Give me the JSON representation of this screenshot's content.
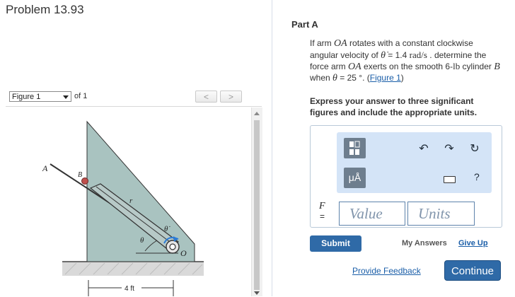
{
  "problem": {
    "title": "Problem 13.93"
  },
  "figure_nav": {
    "selected": "Figure 1",
    "of_text": "of 1",
    "prev_glyph": "<",
    "next_glyph": ">"
  },
  "figure": {
    "label_A": "A",
    "label_B": "B",
    "label_r": "r",
    "label_theta": "θ",
    "label_theta_dot": "θ̇",
    "label_O": "O",
    "dimension": "4 ft"
  },
  "part": {
    "title": "Part A",
    "text_1": "If arm ",
    "arm1": "OA",
    "text_2": " rotates with a constant clockwise angular velocity of ",
    "theta_dot": "θ̇",
    "text_3": " = 1.4 ",
    "unit_rad": "rad/s",
    "text_4": " . determine the force arm ",
    "arm2": "OA",
    "text_5": " exerts on the smooth 6-",
    "unit_lb": "lb",
    "text_6": " cylinder ",
    "cyl": "B",
    "text_7": " when ",
    "theta": "θ",
    "text_8": " = 25 °. (",
    "fig_link": "Figure 1",
    "text_9": ")",
    "express": "Express your answer to three significant figures and include the appropriate units."
  },
  "answer": {
    "var_label": "F",
    "eq": "=",
    "value_placeholder": "Value",
    "units_placeholder": "Units",
    "mu_label": "μÅ",
    "help": "?",
    "icons": [
      "templates-icon",
      "units-icon",
      "undo-icon",
      "redo-icon",
      "reset-icon",
      "keyboard-icon",
      "help-icon"
    ]
  },
  "actions": {
    "submit": "Submit",
    "my_answers": "My Answers",
    "give_up": "Give Up",
    "feedback": "Provide Feedback",
    "continue": "Continue"
  },
  "colors": {
    "accent": "#2f6aa7",
    "link": "#1a5ea8",
    "toolbar_bg": "#d4e4f7",
    "figure_block": "#a9c3c0",
    "cylinder": "#c0504d"
  }
}
